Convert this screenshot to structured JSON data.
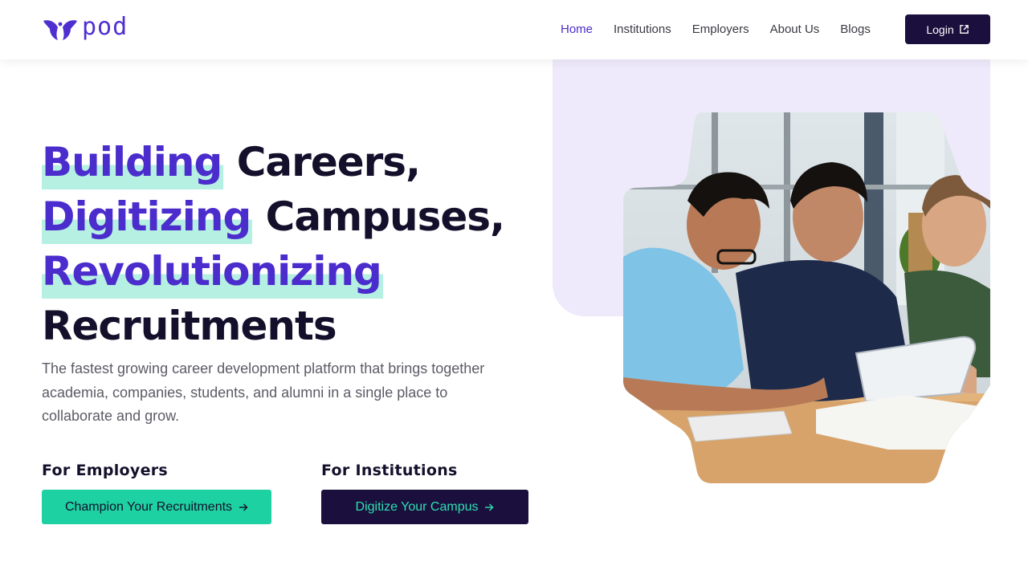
{
  "brand": {
    "name": "pod",
    "color": "#4f2fd0"
  },
  "nav": {
    "items": [
      {
        "label": "Home",
        "active": true
      },
      {
        "label": "Institutions",
        "active": false
      },
      {
        "label": "Employers",
        "active": false
      },
      {
        "label": "About Us",
        "active": false
      },
      {
        "label": "Blogs",
        "active": false
      }
    ],
    "login_label": "Login"
  },
  "hero": {
    "line1_highlight": "Building",
    "line1_rest": " Careers,",
    "line2_highlight": "Digitizing",
    "line2_rest": " Campuses,",
    "line3_highlight": "Revolutionizing",
    "line4": "Recruitments",
    "description": "The fastest growing career development platform that brings together academia, companies, students, and alumni in a single place to collaborate and grow."
  },
  "cta": {
    "employers_label": "For Employers",
    "employers_button": "Champion Your Recruitments",
    "institutions_label": "For Institutions",
    "institutions_button": "Digitize Your Campus"
  },
  "colors": {
    "accent": "#4b2ccc",
    "highlight": "#b6f0e2",
    "green_button": "#1ed1a2",
    "dark_button": "#1a0f3d",
    "blob": "#efeafb"
  }
}
